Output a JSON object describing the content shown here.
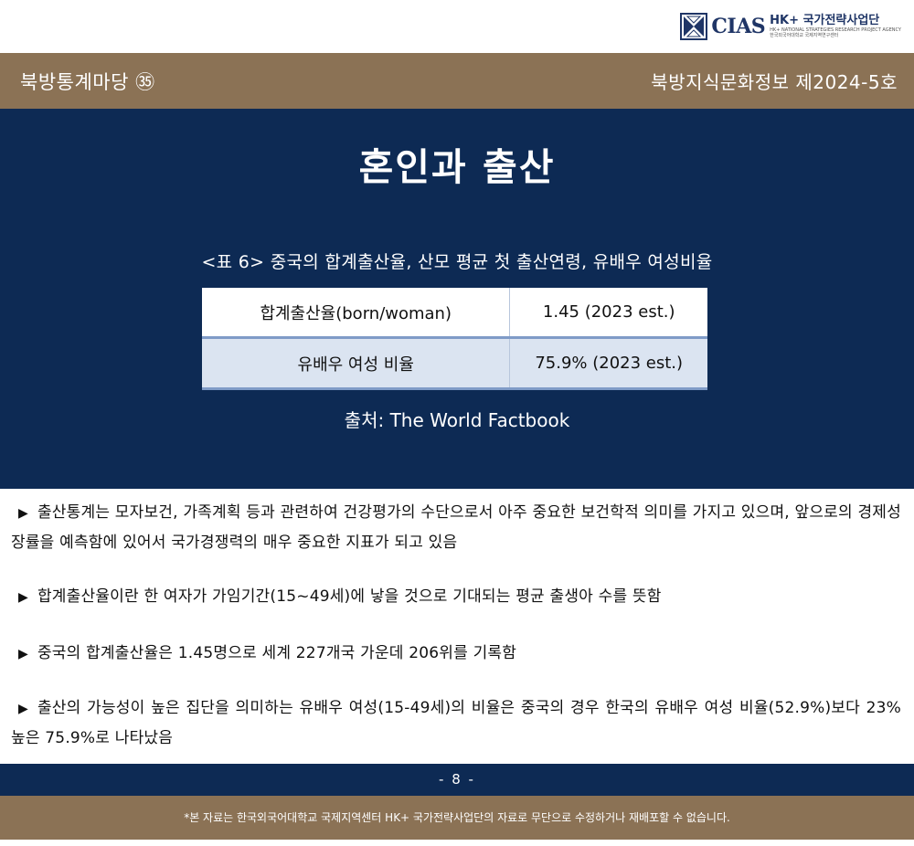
{
  "logo": {
    "brand": "CIAS",
    "title": "HK+ 국가전략사업단",
    "subtitle_en": "HK+ NATIONAL STRATEGIES RESEARCH PROJECT AGENCY",
    "subtitle_kr": "한국외국어대학교 국제지역연구센터"
  },
  "header": {
    "left": "북방통계마당 ㉟",
    "right": "북방지식문화정보 제2024-5호"
  },
  "title": "혼인과 출산",
  "table": {
    "caption": "<표 6> 중국의 합계출산율, 산모 평균 첫 출산연령, 유배우 여성비율",
    "rows": [
      {
        "label": "합계출산율(born/woman)",
        "value": "1.45 (2023 est.)"
      },
      {
        "label": "유배우 여성 비율",
        "value": "75.9% (2023 est.)"
      }
    ],
    "source": "출처: The World Factbook"
  },
  "paragraphs": [
    "출산통계는 모자보건, 가족계획 등과 관련하여 건강평가의 수단으로서 아주 중요한 보건학적 의미를 가지고 있으며, 앞으로의 경제성장률을 예측함에 있어서 국가경쟁력의 매우 중요한 지표가 되고 있음",
    "합계출산율이란 한 여자가 가임기간(15~49세)에 낳을 것으로 기대되는 평균 출생아 수를 뜻함",
    "중국의 합계출산율은 1.45명으로 세계 227개국 가운데 206위를 기록함",
    "출산의 가능성이 높은 집단을 의미하는 유배우 여성(15-49세)의 비율은 중국의 경우 한국의 유배우 여성 비율(52.9%)보다 23% 높은 75.9%로 나타났음"
  ],
  "bullet_symbol": "▶",
  "page_number": "- 8 -",
  "footer": "*본 자료는 한국외국어대학교 국제지역센터 HK+ 국가전략사업단의 자료로 무단으로 수정하거나 재배포할 수 없습니다.",
  "colors": {
    "navy": "#0d2a54",
    "brown": "#8b7255",
    "table_alt_row": "#dbe4f1",
    "table_rule": "#7f9bc7"
  }
}
